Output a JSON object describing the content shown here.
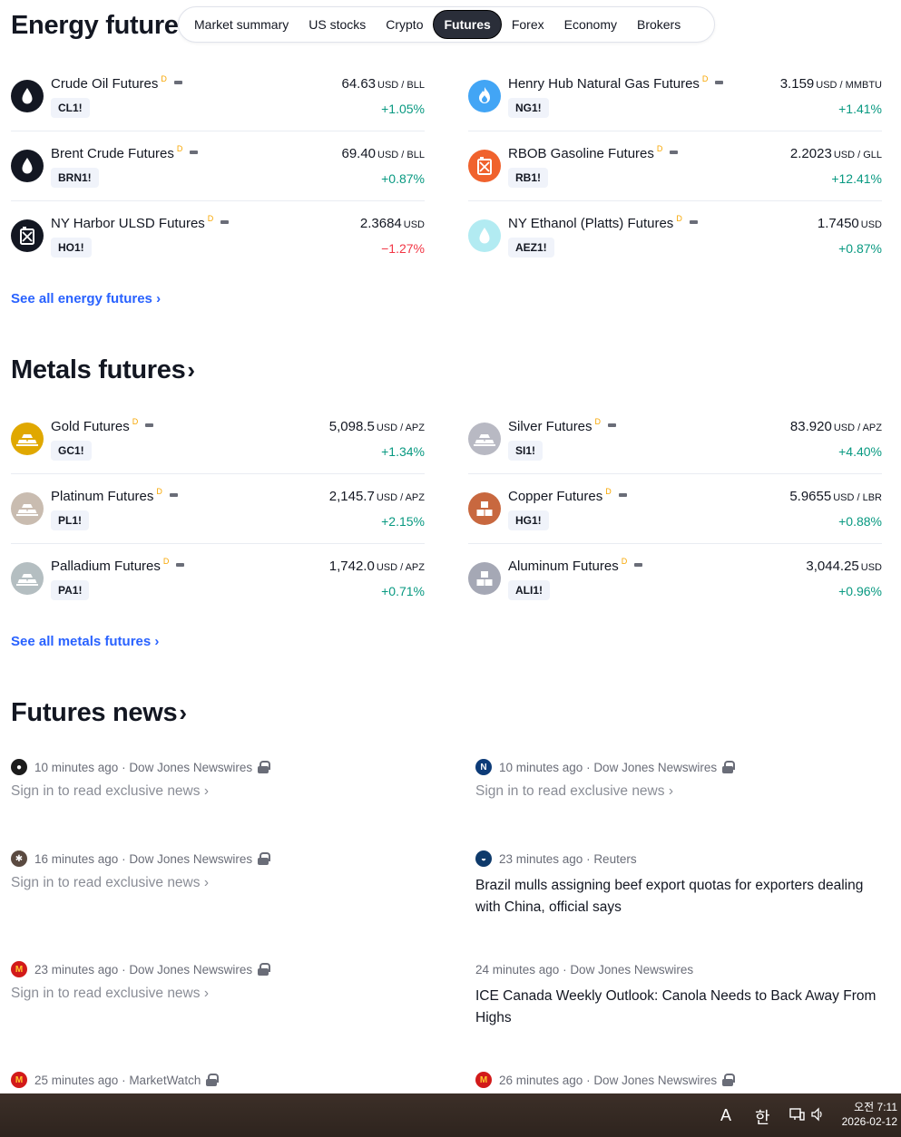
{
  "header": {
    "title": "Energy futures",
    "tabs": [
      {
        "label": "Market summary",
        "active": false
      },
      {
        "label": "US stocks",
        "active": false
      },
      {
        "label": "Crypto",
        "active": false
      },
      {
        "label": "Futures",
        "active": true
      },
      {
        "label": "Forex",
        "active": false
      },
      {
        "label": "Economy",
        "active": false
      },
      {
        "label": "Brokers",
        "active": false
      }
    ]
  },
  "energy": {
    "items": [
      {
        "name": "Crude Oil Futures",
        "flag": "D",
        "ticker": "CL1!",
        "price": "64.63",
        "unit": "USD / BLL",
        "change": "+1.05%",
        "direction": "up",
        "icon": "oil-drop-icon",
        "color": "#131722"
      },
      {
        "name": "Henry Hub Natural Gas Futures",
        "flag": "D",
        "ticker": "NG1!",
        "price": "3.159",
        "unit": "USD / MMBTU",
        "change": "+1.41%",
        "direction": "up",
        "icon": "flame-icon",
        "color": "#42a5f5"
      },
      {
        "name": "Brent Crude Futures",
        "flag": "D",
        "ticker": "BRN1!",
        "price": "69.40",
        "unit": "USD / BLL",
        "change": "+0.87%",
        "direction": "up",
        "icon": "oil-drop-icon",
        "color": "#131722"
      },
      {
        "name": "RBOB Gasoline Futures",
        "flag": "D",
        "ticker": "RB1!",
        "price": "2.2023",
        "unit": "USD / GLL",
        "change": "+12.41%",
        "direction": "up",
        "icon": "fuel-can-icon",
        "color": "#f0622d"
      },
      {
        "name": "NY Harbor ULSD Futures",
        "flag": "D",
        "ticker": "HO1!",
        "price": "2.3684",
        "unit": "USD",
        "change": "−1.27%",
        "direction": "down",
        "icon": "fuel-can-icon",
        "color": "#131722"
      },
      {
        "name": "NY Ethanol (Platts) Futures",
        "flag": "D",
        "ticker": "AEZ1!",
        "price": "1.7450",
        "unit": "USD",
        "change": "+0.87%",
        "direction": "up",
        "icon": "drop-icon",
        "color": "#b2ebf2"
      }
    ],
    "see_all": "See all energy futures"
  },
  "metals": {
    "title": "Metals futures",
    "items": [
      {
        "name": "Gold Futures",
        "flag": "D",
        "ticker": "GC1!",
        "price": "5,098.5",
        "unit": "USD / APZ",
        "change": "+1.34%",
        "direction": "up",
        "icon": "bars-icon",
        "color": "#e0a800"
      },
      {
        "name": "Silver Futures",
        "flag": "D",
        "ticker": "SI1!",
        "price": "83.920",
        "unit": "USD / APZ",
        "change": "+4.40%",
        "direction": "up",
        "icon": "bars-icon",
        "color": "#b8b9c3"
      },
      {
        "name": "Platinum Futures",
        "flag": "D",
        "ticker": "PL1!",
        "price": "2,145.7",
        "unit": "USD / APZ",
        "change": "+2.15%",
        "direction": "up",
        "icon": "bars-icon",
        "color": "#c9bcb0"
      },
      {
        "name": "Copper Futures",
        "flag": "D",
        "ticker": "HG1!",
        "price": "5.9655",
        "unit": "USD / LBR",
        "change": "+0.88%",
        "direction": "up",
        "icon": "blocks-icon",
        "color": "#c8683f"
      },
      {
        "name": "Palladium Futures",
        "flag": "D",
        "ticker": "PA1!",
        "price": "1,742.0",
        "unit": "USD / APZ",
        "change": "+0.71%",
        "direction": "up",
        "icon": "bars-icon",
        "color": "#b4bec1"
      },
      {
        "name": "Aluminum Futures",
        "flag": "D",
        "ticker": "ALI1!",
        "price": "3,044.25",
        "unit": "USD",
        "change": "+0.96%",
        "direction": "up",
        "icon": "blocks-icon",
        "color": "#a5a8b5"
      }
    ],
    "see_all": "See all metals futures"
  },
  "news": {
    "title": "Futures news",
    "items": [
      {
        "time": "10 minutes ago",
        "source": "Dow Jones Newswires",
        "locked": true,
        "text": "Sign in to read exclusive news",
        "icon": "bp-logo-icon",
        "icon_color": "#1b1b1b",
        "icon_glyph": "●"
      },
      {
        "time": "10 minutes ago",
        "source": "Dow Jones Newswires",
        "locked": true,
        "text": "Sign in to read exclusive news",
        "icon": "n-logo-icon",
        "icon_color": "#0d3b78",
        "icon_glyph": "N"
      },
      {
        "time": "16 minutes ago",
        "source": "Dow Jones Newswires",
        "locked": true,
        "text": "Sign in to read exclusive news",
        "icon": "asterisk-logo-icon",
        "icon_color": "#5a4a40",
        "icon_glyph": "✱"
      },
      {
        "time": "23 minutes ago",
        "source": "Reuters",
        "locked": false,
        "text": "Brazil mulls assigning beef export quotas for exporters dealing with China, official says",
        "icon": "globe-logo-icon",
        "icon_color": "#0e3a6b",
        "icon_glyph": "◒"
      },
      {
        "time": "23 minutes ago",
        "source": "Dow Jones Newswires",
        "locked": true,
        "text": "Sign in to read exclusive news",
        "icon": "mcdonalds-logo-icon",
        "icon_color": "#d21a1a",
        "icon_glyph": "M"
      },
      {
        "time": "24 minutes ago",
        "source": "Dow Jones Newswires",
        "locked": false,
        "text": "ICE Canada Weekly Outlook: Canola Needs to Back Away From Highs",
        "icon": "",
        "icon_color": "",
        "icon_glyph": ""
      },
      {
        "time": "25 minutes ago",
        "source": "MarketWatch",
        "locked": true,
        "text": "",
        "icon": "mcdonalds-logo-icon",
        "icon_color": "#d21a1a",
        "icon_glyph": "M"
      },
      {
        "time": "26 minutes ago",
        "source": "Dow Jones Newswires",
        "locked": true,
        "text": "",
        "icon": "mcdonalds-logo-icon",
        "icon_color": "#d21a1a",
        "icon_glyph": "M"
      }
    ]
  },
  "taskbar": {
    "ime_a": "A",
    "ime_korean": "한",
    "time": "오전 7:11",
    "date": "2026-02-12"
  },
  "colors": {
    "up": "#089981",
    "down": "#f23645",
    "link": "#2962ff"
  }
}
